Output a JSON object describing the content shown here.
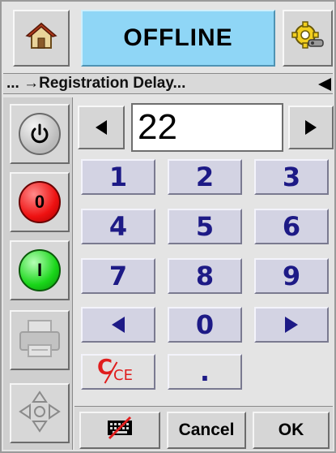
{
  "header": {
    "status_title": "OFFLINE"
  },
  "breadcrumb": {
    "text": "... →Registration Delay..."
  },
  "value_entry": {
    "current_value": "22"
  },
  "keypad": {
    "keys": [
      "1",
      "2",
      "3",
      "4",
      "5",
      "6",
      "7",
      "8",
      "9",
      "◀",
      "0",
      "▶"
    ],
    "clear_label": "C/CE",
    "clear_main": "C",
    "clear_sub": "CE",
    "decimal_label": "."
  },
  "left_panel": {
    "stop_label": "0",
    "start_label": "I"
  },
  "bottom_bar": {
    "cancel_label": "Cancel",
    "ok_label": "OK"
  },
  "colors": {
    "title_bg": "#8fd6f6",
    "key_text": "#1d1a86",
    "stop_red": "#ee1111",
    "start_green": "#19d619",
    "clear_red": "#e01d1d"
  }
}
